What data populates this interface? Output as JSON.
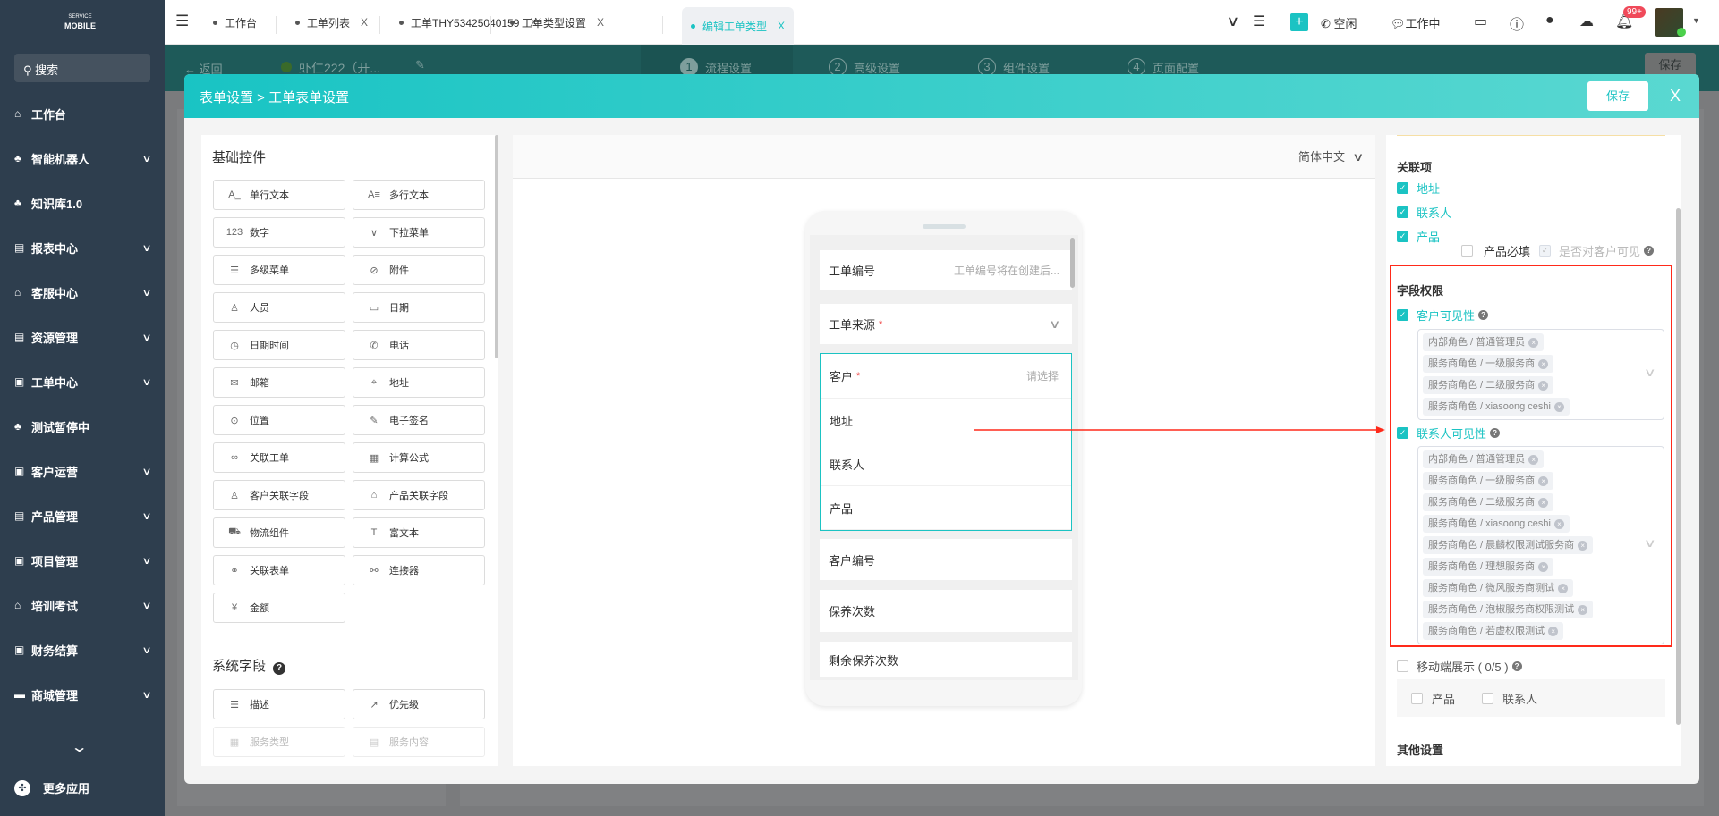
{
  "logo": {
    "line1": "SERVICE",
    "line2": "MOBILE"
  },
  "sidebar": {
    "search": "搜索",
    "items": [
      {
        "label": "工作台",
        "icon": "home-icon",
        "chev": false
      },
      {
        "label": "智能机器人",
        "icon": "org-icon",
        "chev": true
      },
      {
        "label": "知识库1.0",
        "icon": "org-icon",
        "chev": false
      },
      {
        "label": "报表中心",
        "icon": "report-icon",
        "chev": true
      },
      {
        "label": "客服中心",
        "icon": "home-icon",
        "chev": true
      },
      {
        "label": "资源管理",
        "icon": "report-icon",
        "chev": true
      },
      {
        "label": "工单中心",
        "icon": "clipboard-icon",
        "chev": true
      },
      {
        "label": "测试暂停中",
        "icon": "org-icon",
        "chev": false
      },
      {
        "label": "客户运营",
        "icon": "contact-icon",
        "chev": true
      },
      {
        "label": "产品管理",
        "icon": "product-icon",
        "chev": true
      },
      {
        "label": "项目管理",
        "icon": "contact-icon",
        "chev": true
      },
      {
        "label": "培训考试",
        "icon": "home-icon",
        "chev": true
      },
      {
        "label": "财务结算",
        "icon": "finance-icon",
        "chev": true
      },
      {
        "label": "商城管理",
        "icon": "store-icon",
        "chev": true
      }
    ],
    "more": "更多应用"
  },
  "tabs": [
    {
      "label": "工作台",
      "close": false
    },
    {
      "label": "工单列表",
      "close": true
    },
    {
      "label": "工单THY53425040159",
      "close": true
    },
    {
      "label": "工单类型设置",
      "close": true
    },
    {
      "label": "编辑工单类型",
      "close": true,
      "active": true
    }
  ],
  "tab_close": "X",
  "topbar": {
    "idle": "空闲",
    "working": "工作中",
    "badge": "99+"
  },
  "subbar": {
    "back": "返回",
    "title": "虾仁222（开...",
    "steps": [
      "流程设置",
      "高级设置",
      "组件设置",
      "页面配置"
    ],
    "save": "保存"
  },
  "modal": {
    "title": "表单设置 > 工单表单设置",
    "save": "保存",
    "close": "X"
  },
  "left": {
    "basic_title": "基础控件",
    "basic": [
      {
        "label": "单行文本",
        "icon": "A_"
      },
      {
        "label": "多行文本",
        "icon": "A≡"
      },
      {
        "label": "数字",
        "icon": "123"
      },
      {
        "label": "下拉菜单",
        "icon": "∨"
      },
      {
        "label": "多级菜单",
        "icon": "☰"
      },
      {
        "label": "附件",
        "icon": "⊘"
      },
      {
        "label": "人员",
        "icon": "♙"
      },
      {
        "label": "日期",
        "icon": "▭"
      },
      {
        "label": "日期时间",
        "icon": "◷"
      },
      {
        "label": "电话",
        "icon": "✆"
      },
      {
        "label": "邮箱",
        "icon": "✉"
      },
      {
        "label": "地址",
        "icon": "⌖"
      },
      {
        "label": "位置",
        "icon": "⊙"
      },
      {
        "label": "电子签名",
        "icon": "✎"
      },
      {
        "label": "关联工单",
        "icon": "∞"
      },
      {
        "label": "计算公式",
        "icon": "▦"
      },
      {
        "label": "客户关联字段",
        "icon": "♙"
      },
      {
        "label": "产品关联字段",
        "icon": "⌂"
      },
      {
        "label": "物流组件",
        "icon": "⛟"
      },
      {
        "label": "富文本",
        "icon": "T"
      },
      {
        "label": "关联表单",
        "icon": "⚭"
      },
      {
        "label": "连接器",
        "icon": "⚯"
      },
      {
        "label": "金额",
        "icon": "¥"
      }
    ],
    "system_title": "系统字段",
    "system": [
      {
        "label": "描述",
        "icon": "☰"
      },
      {
        "label": "优先级",
        "icon": "↗"
      },
      {
        "label": "服务类型",
        "icon": "▦",
        "disabled": true
      },
      {
        "label": "服务内容",
        "icon": "▤",
        "disabled": true
      }
    ]
  },
  "center": {
    "language": "简体中文",
    "rows": [
      {
        "label": "工单编号",
        "placeholder": "工单编号将在创建后..."
      },
      {
        "label": "工单来源",
        "required": true
      },
      {
        "label": "客户",
        "required": true,
        "placeholder": "请选择"
      },
      {
        "label": "地址"
      },
      {
        "label": "联系人"
      },
      {
        "label": "产品"
      },
      {
        "label": "客户编号"
      },
      {
        "label": "保养次数"
      },
      {
        "label": "剩余保养次数"
      }
    ]
  },
  "right": {
    "related_title": "关联项",
    "related": [
      {
        "label": "地址",
        "checked": true
      },
      {
        "label": "联系人",
        "checked": true
      },
      {
        "label": "产品",
        "checked": true
      }
    ],
    "product_required": "产品必填",
    "customer_visible": "是否对客户可见",
    "perm_title": "字段权限",
    "customer_vis": "客户可见性",
    "contact_vis": "联系人可见性",
    "customer_tags": [
      "内部角色 / 普通管理员",
      "服务商角色 / 一级服务商",
      "服务商角色 / 二级服务商",
      "服务商角色 / xiasoong ceshi"
    ],
    "contact_tags": [
      "内部角色 / 普通管理员",
      "服务商角色 / 一级服务商",
      "服务商角色 / 二级服务商",
      "服务商角色 / xiasoong ceshi",
      "服务商角色 / 晨麟权限测试服务商",
      "服务商角色 / 理想服务商",
      "服务商角色 / 微风服务商测试",
      "服务商角色 / 泡椒服务商权限测试",
      "服务商角色 / 若虚权限测试"
    ],
    "mobile": "移动端展示 ( 0/5 )",
    "mobile_opts": [
      "产品",
      "联系人"
    ],
    "other_title": "其他设置"
  },
  "colors": {
    "accent": "#1bc3c3",
    "highlight": "#ff2a1a"
  }
}
